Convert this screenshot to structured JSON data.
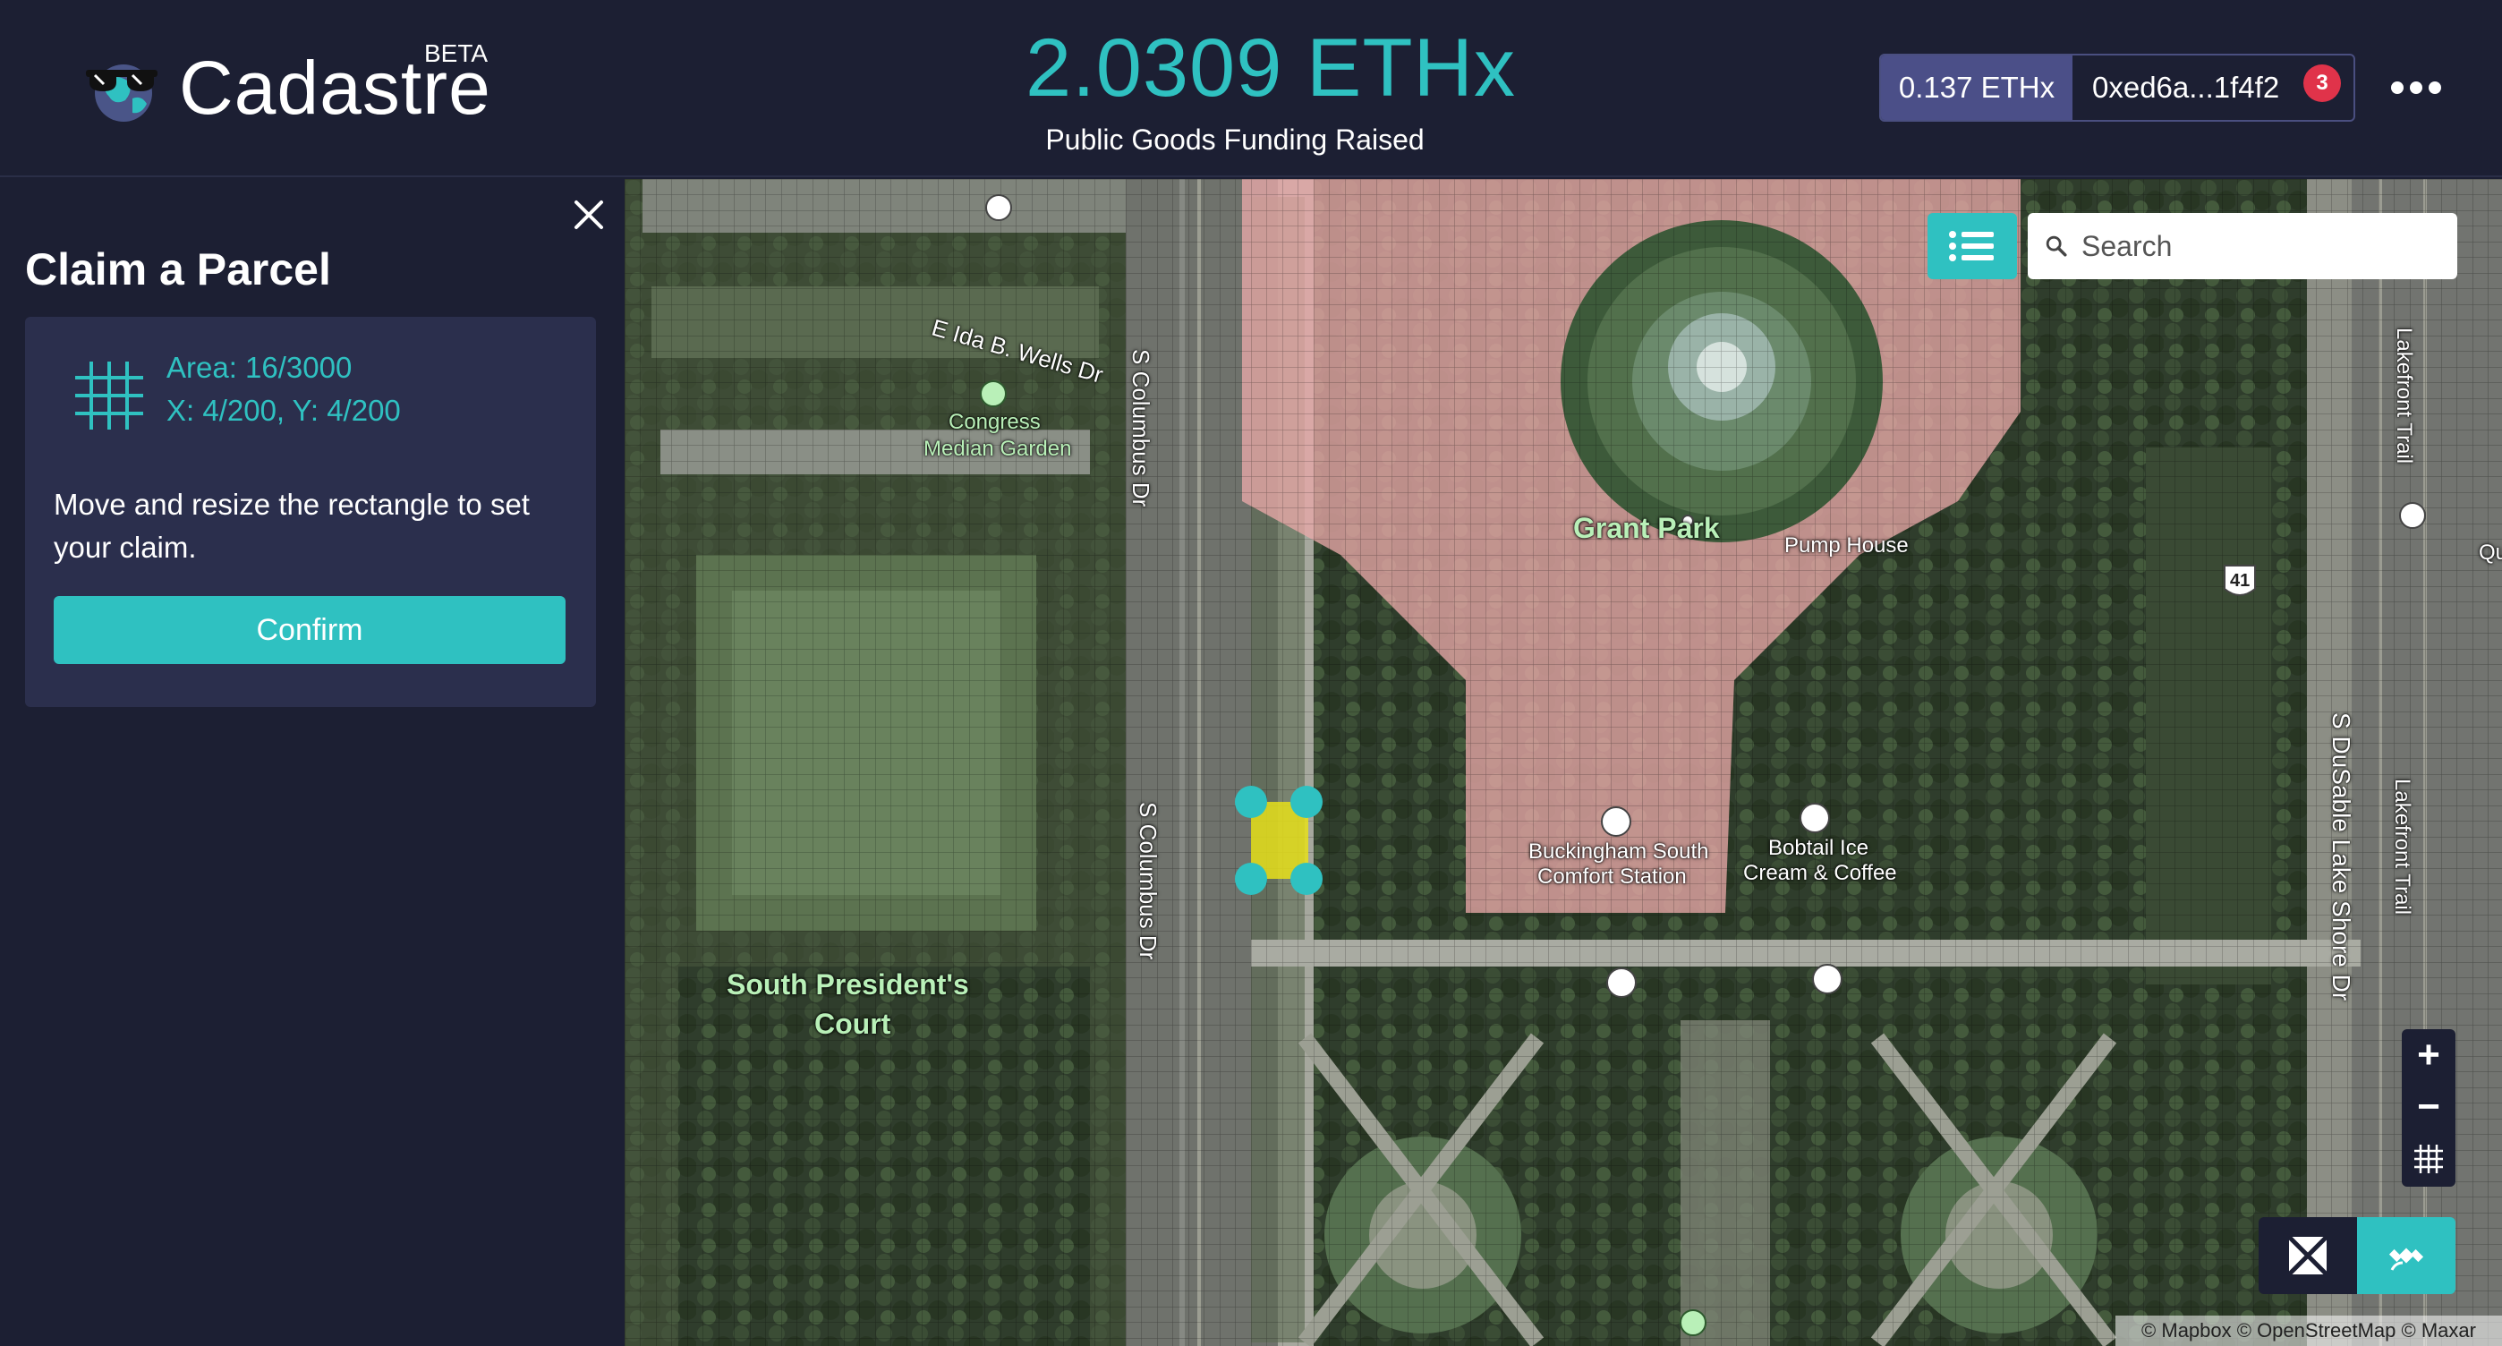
{
  "header": {
    "brand": "Cadastre",
    "beta": "BETA",
    "raised_amount": "2.0309 ETHx",
    "raised_label": "Public Goods Funding Raised",
    "wallet_balance": "0.137 ETHx",
    "wallet_address": "0xed6a...1f4f2",
    "notification_count": "3"
  },
  "sidebar": {
    "title": "Claim a Parcel",
    "area": "Area: 16/3000",
    "coords": "X: 4/200, Y: 4/200",
    "instructions": "Move and resize the rectangle to set your claim.",
    "confirm_label": "Confirm"
  },
  "map": {
    "search_placeholder": "Search",
    "zoom_in": "+",
    "zoom_out": "−",
    "attribution": "© Mapbox © OpenStreetMap © Maxar",
    "labels": {
      "ida_wells": "E Ida B. Wells Dr",
      "congress_garden_1": "Congress",
      "congress_garden_2": "Median Garden",
      "columbus_1": "S Columbus Dr",
      "columbus_2": "S Columbus Dr",
      "grant_park": "Grant Park",
      "pump_house": "Pump House",
      "lakefront_1": "Lakefront Trail",
      "lakefront_2": "Lakefront Trail",
      "dusable": "S DuSable Lake Shore Dr",
      "buckingham_1": "Buckingham South",
      "buckingham_2": "Comfort Station",
      "bobtail_1": "Bobtail Ice",
      "bobtail_2": "Cream & Coffee",
      "presidents_1": "South President's",
      "presidents_2": "Court",
      "highway_shield": "41",
      "edge_label": "Qu"
    }
  },
  "colors": {
    "background": "#1c1f33",
    "accent": "#2fc1c1",
    "wallet_balance_bg": "#4b4f88",
    "badge": "#e0334a",
    "claimed_area": "#e8a8a8",
    "selection": "#e6e01a"
  },
  "icons": {
    "logo": "globe-sunglasses-icon",
    "close": "close-icon",
    "grid": "grid-icon",
    "list": "list-icon",
    "search": "search-icon",
    "grid_toggle": "grid-toggle-icon",
    "street_style": "map-street-icon",
    "satellite_style": "satellite-icon"
  }
}
